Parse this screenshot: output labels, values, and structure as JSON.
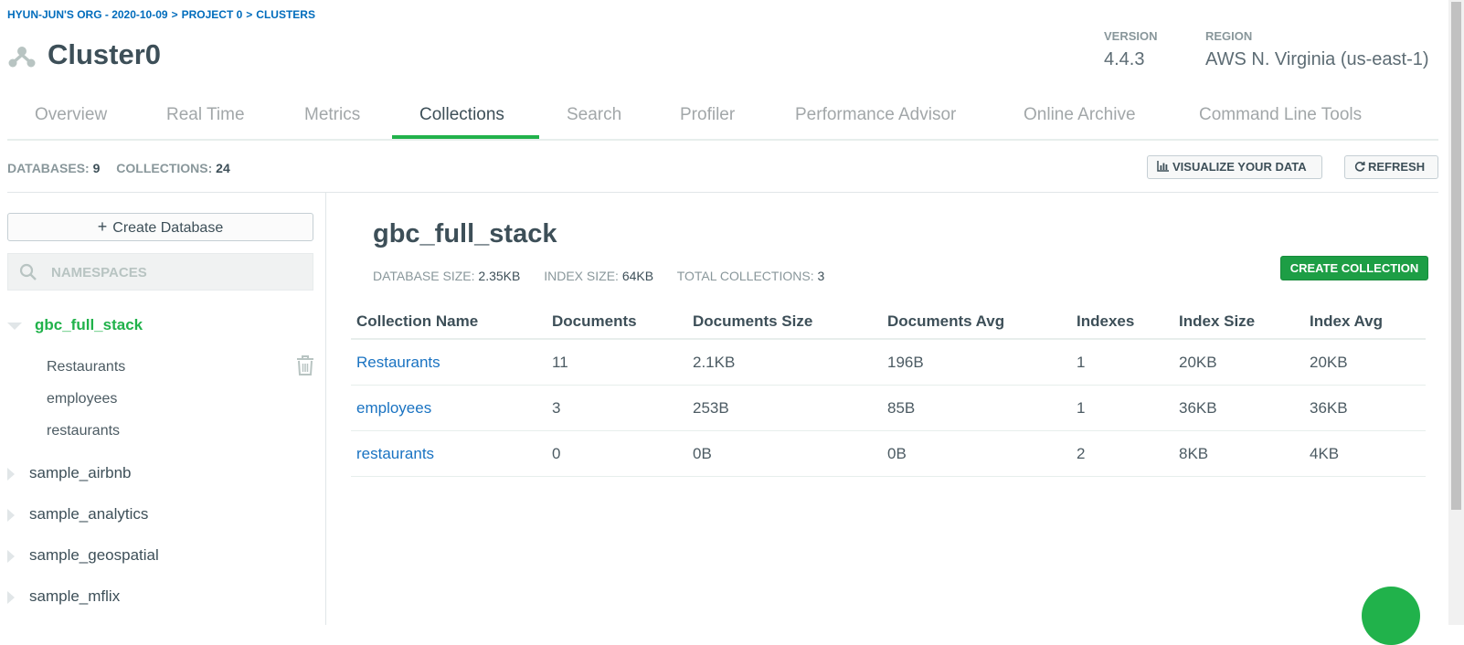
{
  "breadcrumb": [
    "HYUN-JUN'S ORG - 2020-10-09",
    ">",
    "PROJECT 0",
    ">",
    "CLUSTERS"
  ],
  "cluster": {
    "title": "Cluster0",
    "version_label": "VERSION",
    "version": "4.4.3",
    "region_label": "REGION",
    "region": "AWS N. Virginia (us-east-1)"
  },
  "tabs": [
    "Overview",
    "Real Time",
    "Metrics",
    "Collections",
    "Search",
    "Profiler",
    "Performance Advisor",
    "Online Archive",
    "Command Line Tools"
  ],
  "active_tab": "Collections",
  "stats": {
    "databases_label": "DATABASES:",
    "databases": "9",
    "collections_label": "COLLECTIONS:",
    "collections": "24"
  },
  "buttons": {
    "visualize": "VISUALIZE YOUR DATA",
    "refresh": "REFRESH",
    "create_database": "Create Database",
    "create_collection": "CREATE COLLECTION"
  },
  "search": {
    "placeholder": "NAMESPACES"
  },
  "sidebar": {
    "active_db": "gbc_full_stack",
    "active_collections": [
      "Restaurants",
      "employees",
      "restaurants"
    ],
    "other_dbs": [
      "sample_airbnb",
      "sample_analytics",
      "sample_geospatial",
      "sample_mflix"
    ]
  },
  "database": {
    "name": "gbc_full_stack",
    "size_label": "DATABASE SIZE:",
    "size": "2.35KB",
    "index_size_label": "INDEX SIZE:",
    "index_size": "64KB",
    "total_collections_label": "TOTAL COLLECTIONS:",
    "total_collections": "3"
  },
  "table": {
    "headers": [
      "Collection Name",
      "Documents",
      "Documents Size",
      "Documents Avg",
      "Indexes",
      "Index Size",
      "Index Avg"
    ],
    "rows": [
      [
        "Restaurants",
        "11",
        "2.1KB",
        "196B",
        "1",
        "20KB",
        "20KB"
      ],
      [
        "employees",
        "3",
        "253B",
        "85B",
        "1",
        "36KB",
        "36KB"
      ],
      [
        "restaurants",
        "0",
        "0B",
        "0B",
        "2",
        "8KB",
        "4KB"
      ]
    ]
  },
  "colors": {
    "accent_green": "#21b24b",
    "button_green": "#1d9e45",
    "link_blue": "#1a73c2",
    "breadcrumb_blue": "#006cbc"
  }
}
